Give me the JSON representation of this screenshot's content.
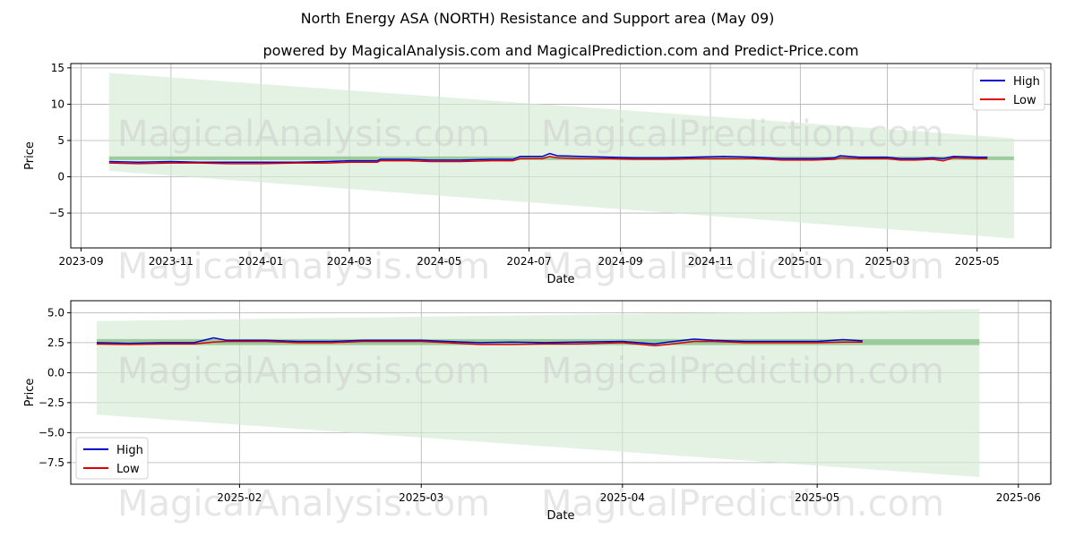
{
  "title": "North Energy ASA (NORTH) Resistance and Support area (May 09)",
  "subtitle": "powered by MagicalAnalysis.com and MagicalPrediction.com and Predict-Price.com",
  "watermark": [
    "MagicalAnalysis.com",
    "MagicalPrediction.com"
  ],
  "colors": {
    "high": "#0000cc",
    "low": "#dd0000",
    "band": "#8fc48f",
    "cone": "#d4ebd4"
  },
  "chart_data": [
    {
      "type": "line",
      "xlabel": "Date",
      "ylabel": "Price",
      "xlim": [
        "2023-08-25",
        "2025-06-20"
      ],
      "ylim": [
        -9.8,
        15.6
      ],
      "xticks": [
        "2023-09",
        "2023-11",
        "2024-01",
        "2024-03",
        "2024-05",
        "2024-07",
        "2024-09",
        "2024-11",
        "2025-01",
        "2025-03",
        "2025-05"
      ],
      "yticks": [
        15,
        10,
        5,
        0,
        -5
      ],
      "legend": "top-right",
      "support_resistance_band": {
        "x": [
          "2023-09-20",
          "2025-05-26"
        ],
        "low": 2.3,
        "high": 2.8
      },
      "prediction_cone": {
        "x": [
          "2023-09-20",
          "2025-05-26"
        ],
        "upper": [
          14.3,
          5.3
        ],
        "lower": [
          0.8,
          -8.5
        ]
      },
      "series": [
        {
          "name": "High",
          "x": [
            "2023-09-20",
            "2023-10-10",
            "2023-11-01",
            "2023-11-20",
            "2023-12-10",
            "2024-01-01",
            "2024-01-25",
            "2024-02-15",
            "2024-03-01",
            "2024-03-20",
            "2024-03-22",
            "2024-04-10",
            "2024-04-25",
            "2024-05-15",
            "2024-06-05",
            "2024-06-20",
            "2024-06-25",
            "2024-07-10",
            "2024-07-15",
            "2024-07-20",
            "2024-08-05",
            "2024-08-25",
            "2024-09-10",
            "2024-10-01",
            "2024-10-20",
            "2024-11-10",
            "2024-12-01",
            "2024-12-20",
            "2025-01-10",
            "2025-01-24",
            "2025-01-28",
            "2025-02-10",
            "2025-02-20",
            "2025-03-01",
            "2025-03-10",
            "2025-03-20",
            "2025-04-01",
            "2025-04-08",
            "2025-04-15",
            "2025-05-01",
            "2025-05-08"
          ],
          "values": [
            2.1,
            2.0,
            2.1,
            2.0,
            2.0,
            2.0,
            2.0,
            2.1,
            2.2,
            2.2,
            2.4,
            2.4,
            2.3,
            2.3,
            2.4,
            2.4,
            2.8,
            2.8,
            3.2,
            2.9,
            2.8,
            2.7,
            2.6,
            2.6,
            2.7,
            2.8,
            2.7,
            2.5,
            2.5,
            2.6,
            2.9,
            2.7,
            2.7,
            2.7,
            2.5,
            2.5,
            2.6,
            2.5,
            2.8,
            2.7,
            2.7
          ]
        },
        {
          "name": "Low",
          "x": [
            "2023-09-20",
            "2023-10-10",
            "2023-11-01",
            "2023-11-20",
            "2023-12-10",
            "2024-01-01",
            "2024-01-25",
            "2024-02-15",
            "2024-03-01",
            "2024-03-20",
            "2024-03-22",
            "2024-04-10",
            "2024-04-25",
            "2024-05-15",
            "2024-06-05",
            "2024-06-20",
            "2024-06-25",
            "2024-07-10",
            "2024-07-15",
            "2024-07-20",
            "2024-08-05",
            "2024-08-25",
            "2024-09-10",
            "2024-10-01",
            "2024-10-20",
            "2024-11-10",
            "2024-12-01",
            "2024-12-20",
            "2025-01-10",
            "2025-01-24",
            "2025-01-28",
            "2025-02-10",
            "2025-02-20",
            "2025-03-01",
            "2025-03-10",
            "2025-03-20",
            "2025-04-01",
            "2025-04-08",
            "2025-04-15",
            "2025-05-01",
            "2025-05-08"
          ],
          "values": [
            1.9,
            1.8,
            1.9,
            1.9,
            1.8,
            1.8,
            1.9,
            1.9,
            2.0,
            2.0,
            2.2,
            2.2,
            2.1,
            2.1,
            2.2,
            2.2,
            2.5,
            2.5,
            2.8,
            2.6,
            2.5,
            2.5,
            2.4,
            2.4,
            2.5,
            2.5,
            2.5,
            2.3,
            2.3,
            2.4,
            2.6,
            2.5,
            2.5,
            2.5,
            2.3,
            2.3,
            2.4,
            2.2,
            2.6,
            2.5,
            2.5
          ]
        }
      ]
    },
    {
      "type": "line",
      "xlabel": "Date",
      "ylabel": "Price",
      "xlim": [
        "2025-01-06",
        "2025-06-06"
      ],
      "ylim": [
        -9.3,
        6.0
      ],
      "xticks": [
        "2025-02",
        "2025-03",
        "2025-04",
        "2025-05",
        "2025-06"
      ],
      "yticks": [
        5.0,
        2.5,
        0.0,
        -2.5,
        -5.0,
        -7.5
      ],
      "legend": "bottom-left",
      "support_resistance_band": {
        "x": [
          "2025-01-10",
          "2025-05-26"
        ],
        "low": 2.3,
        "high": 2.8
      },
      "prediction_cone": {
        "x": [
          "2025-01-10",
          "2025-05-26"
        ],
        "upper": [
          4.3,
          5.3
        ],
        "lower": [
          -3.5,
          -8.7
        ]
      },
      "series": [
        {
          "name": "High",
          "x": [
            "2025-01-10",
            "2025-01-15",
            "2025-01-20",
            "2025-01-25",
            "2025-01-28",
            "2025-01-30",
            "2025-02-05",
            "2025-02-10",
            "2025-02-15",
            "2025-02-20",
            "2025-02-25",
            "2025-03-01",
            "2025-03-05",
            "2025-03-10",
            "2025-03-15",
            "2025-03-20",
            "2025-03-25",
            "2025-04-01",
            "2025-04-06",
            "2025-04-08",
            "2025-04-12",
            "2025-04-15",
            "2025-04-20",
            "2025-04-25",
            "2025-05-01",
            "2025-05-05",
            "2025-05-08"
          ],
          "values": [
            2.5,
            2.45,
            2.5,
            2.5,
            2.9,
            2.7,
            2.7,
            2.6,
            2.6,
            2.7,
            2.7,
            2.7,
            2.6,
            2.5,
            2.55,
            2.5,
            2.55,
            2.6,
            2.4,
            2.55,
            2.8,
            2.7,
            2.6,
            2.6,
            2.6,
            2.75,
            2.65
          ]
        },
        {
          "name": "Low",
          "x": [
            "2025-01-10",
            "2025-01-15",
            "2025-01-20",
            "2025-01-25",
            "2025-01-28",
            "2025-01-30",
            "2025-02-05",
            "2025-02-10",
            "2025-02-15",
            "2025-02-20",
            "2025-02-25",
            "2025-03-01",
            "2025-03-05",
            "2025-03-10",
            "2025-03-15",
            "2025-03-20",
            "2025-03-25",
            "2025-04-01",
            "2025-04-06",
            "2025-04-08",
            "2025-04-12",
            "2025-04-15",
            "2025-04-20",
            "2025-04-25",
            "2025-05-01",
            "2025-05-05",
            "2025-05-08"
          ],
          "values": [
            2.4,
            2.35,
            2.4,
            2.4,
            2.55,
            2.6,
            2.6,
            2.5,
            2.5,
            2.6,
            2.6,
            2.6,
            2.5,
            2.35,
            2.35,
            2.4,
            2.4,
            2.5,
            2.25,
            2.35,
            2.6,
            2.6,
            2.5,
            2.5,
            2.5,
            2.55,
            2.55
          ]
        }
      ]
    }
  ]
}
